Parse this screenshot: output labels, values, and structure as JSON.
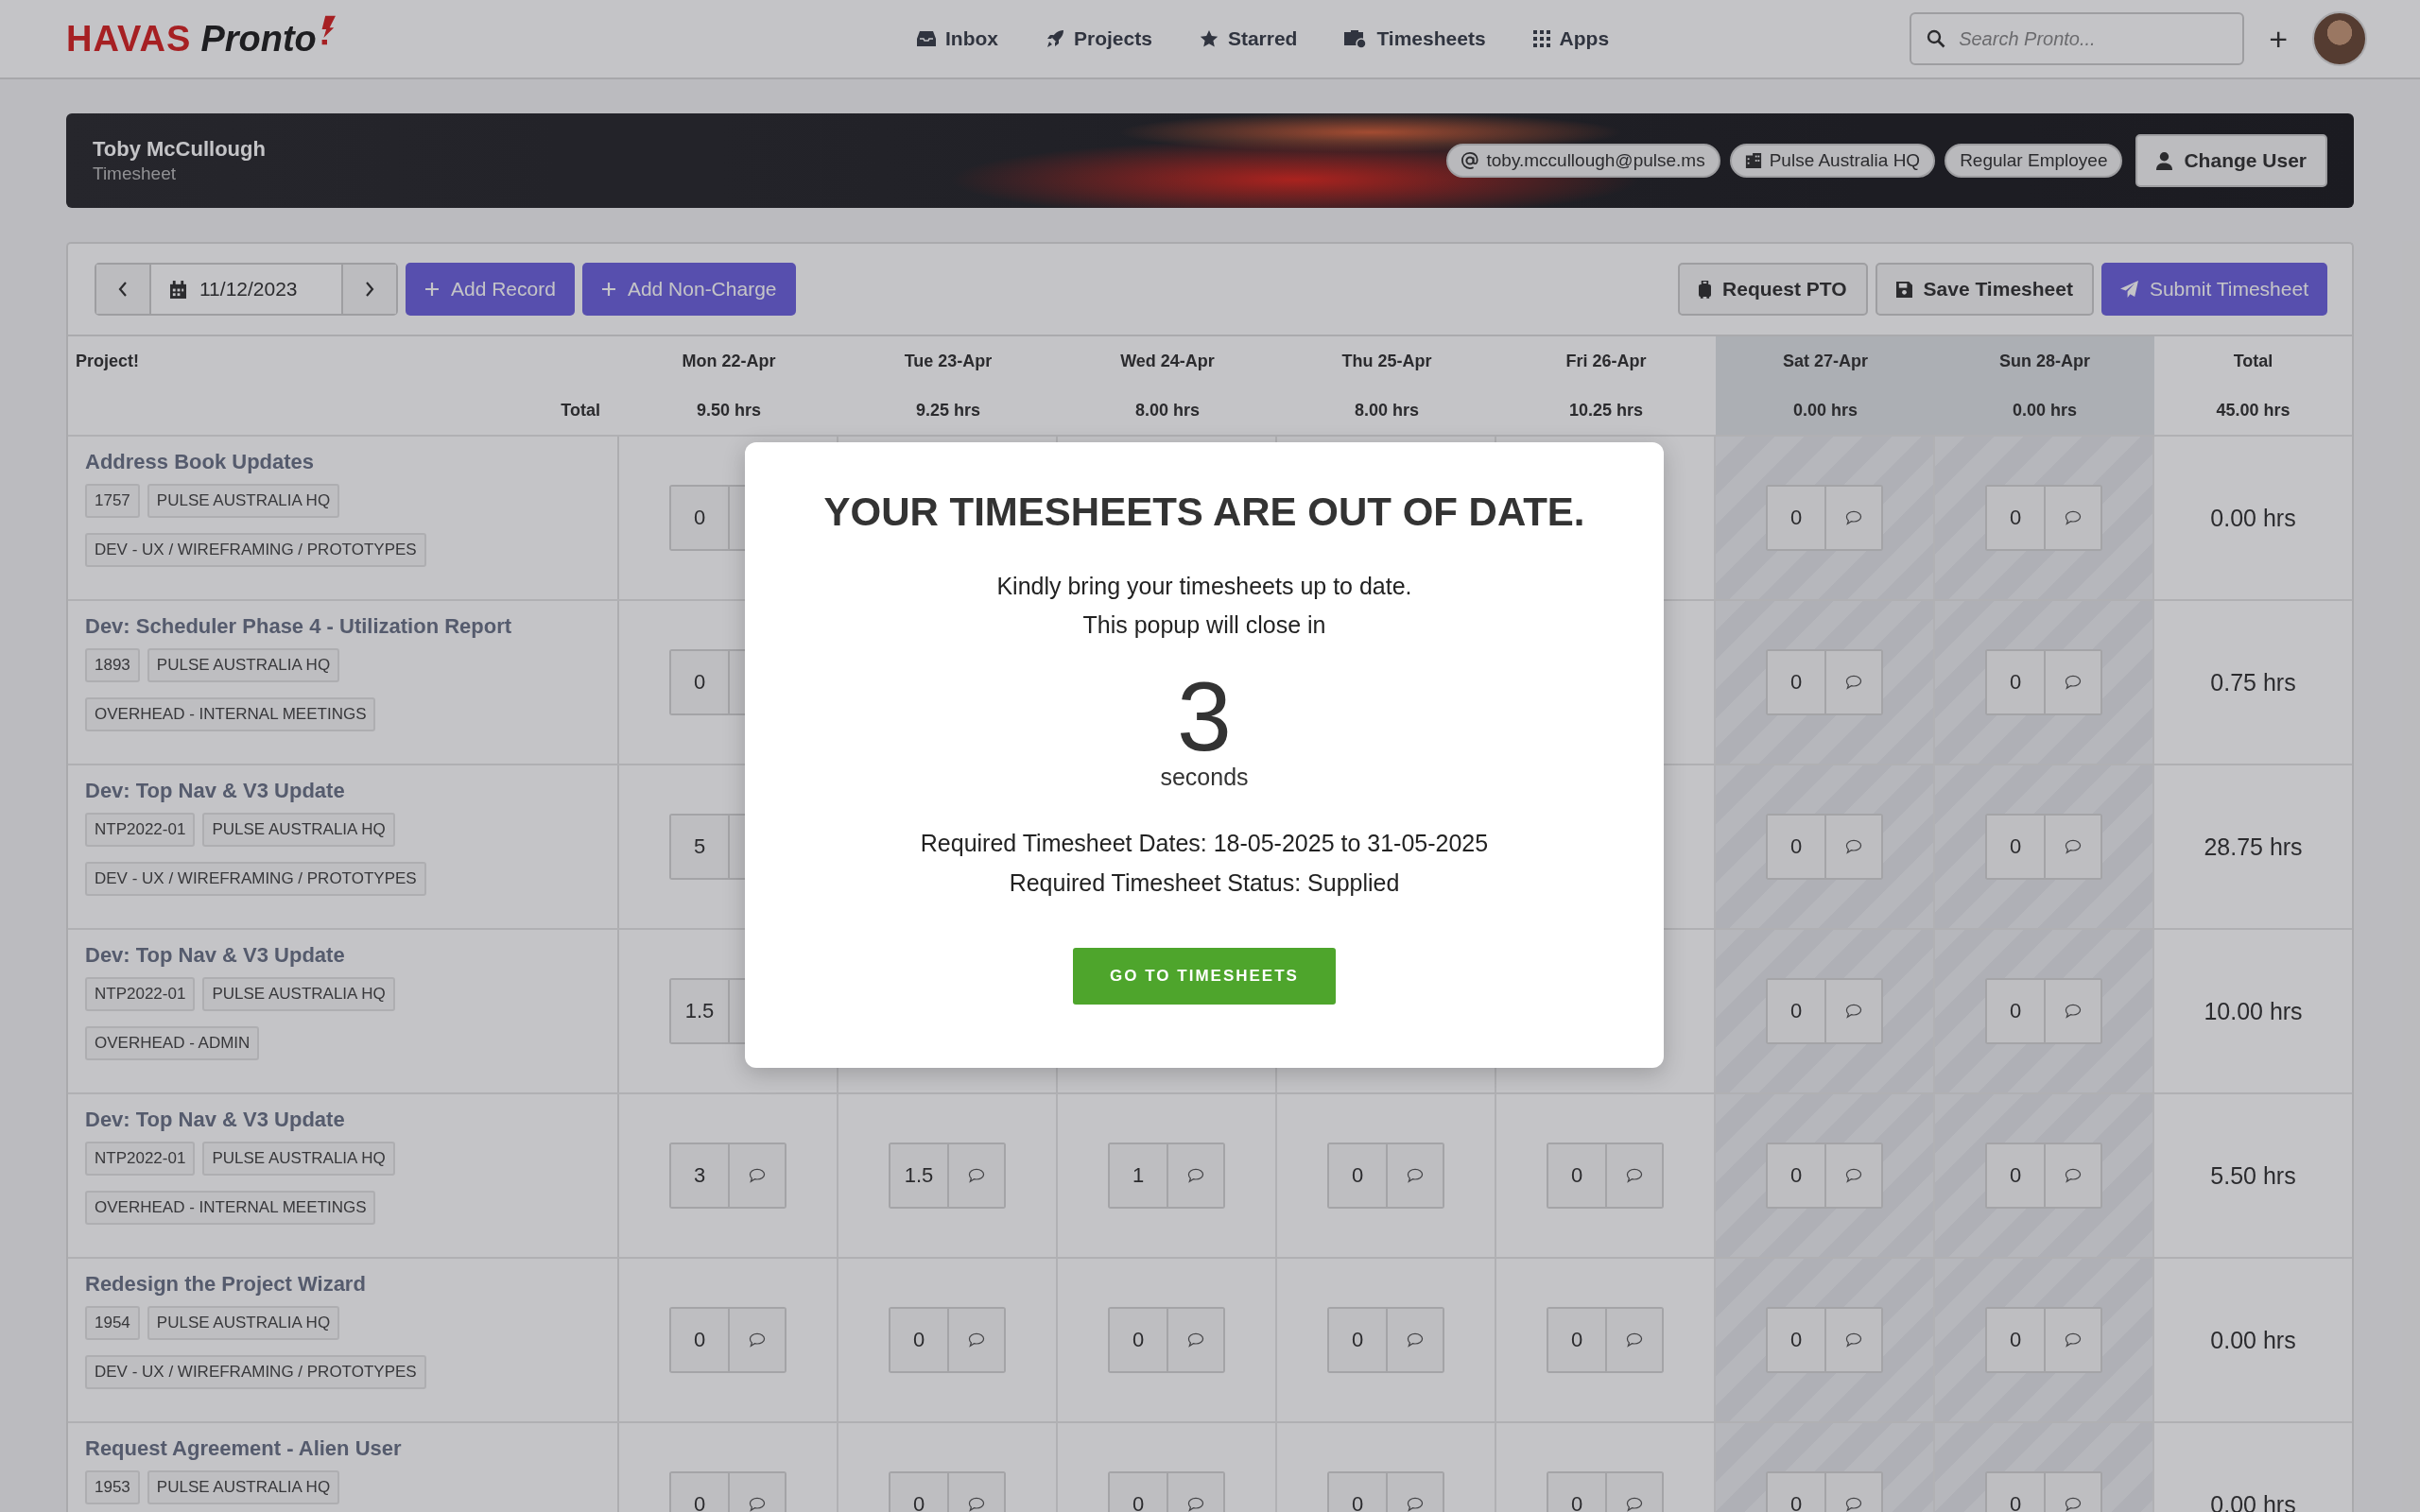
{
  "nav": {
    "brand": "HAVAS",
    "product": "Pronto",
    "items": [
      {
        "label": "Inbox"
      },
      {
        "label": "Projects"
      },
      {
        "label": "Starred"
      },
      {
        "label": "Timesheets"
      },
      {
        "label": "Apps"
      }
    ],
    "search": {
      "placeholder": "Search Pronto..."
    },
    "add": "+"
  },
  "header": {
    "name": "Toby McCullough",
    "subtitle": "Timesheet",
    "badges": [
      {
        "kind": "email",
        "label": "toby.mccullough@pulse.ms"
      },
      {
        "kind": "office",
        "label": "Pulse Australia HQ"
      },
      {
        "kind": "plain",
        "label": "Regular Employee"
      }
    ],
    "change_user": "Change User"
  },
  "toolbar": {
    "date": "11/12/2023",
    "left_buttons": [
      "Add Record",
      "Add Non-Charge"
    ],
    "right_buttons": [
      {
        "kind": "pto",
        "label": "Request PTO"
      },
      {
        "kind": "save",
        "label": "Save Timesheet"
      },
      {
        "kind": "submit",
        "label": "Submit Timesheet"
      }
    ]
  },
  "table": {
    "project_heading": "Project!",
    "total_label": "Total",
    "days": [
      {
        "label": "Mon 22-Apr",
        "total": "9.50 hrs",
        "weekend": false
      },
      {
        "label": "Tue 23-Apr",
        "total": "9.25 hrs",
        "weekend": false
      },
      {
        "label": "Wed 24-Apr",
        "total": "8.00 hrs",
        "weekend": false
      },
      {
        "label": "Thu 25-Apr",
        "total": "8.00 hrs",
        "weekend": false
      },
      {
        "label": "Fri 26-Apr",
        "total": "10.25 hrs",
        "weekend": false
      },
      {
        "label": "Sat 27-Apr",
        "total": "0.00 hrs",
        "weekend": true
      },
      {
        "label": "Sun 28-Apr",
        "total": "0.00 hrs",
        "weekend": true
      }
    ],
    "total_column": {
      "label": "Total",
      "total": "45.00 hrs"
    },
    "rows": [
      {
        "name": "Address Book Updates",
        "tags": [
          "1757",
          "PULSE AUSTRALIA HQ"
        ],
        "category": "DEV - UX / WIREFRAMING / PROTOTYPES",
        "hours": {
          "mon": "0",
          "sat": "0",
          "sun": "0"
        },
        "total": "0.00 hrs"
      },
      {
        "name": "Dev: Scheduler Phase 4 - Utilization Report",
        "tags": [
          "1893",
          "PULSE AUSTRALIA HQ"
        ],
        "category": "OVERHEAD - INTERNAL MEETINGS",
        "hours": {
          "mon": "0",
          "sat": "0",
          "sun": "0"
        },
        "total": "0.75 hrs"
      },
      {
        "name": "Dev: Top Nav & V3 Update",
        "tags": [
          "NTP2022-01",
          "PULSE AUSTRALIA HQ"
        ],
        "category": "DEV - UX / WIREFRAMING / PROTOTYPES",
        "hours": {
          "mon": "5",
          "sat": "0",
          "sun": "0"
        },
        "total": "28.75 hrs"
      },
      {
        "name": "Dev: Top Nav & V3 Update",
        "tags": [
          "NTP2022-01",
          "PULSE AUSTRALIA HQ"
        ],
        "category": "OVERHEAD - ADMIN",
        "hours": {
          "mon": "1.5",
          "sat": "0",
          "sun": "0"
        },
        "total": "10.00 hrs"
      },
      {
        "name": "Dev: Top Nav & V3 Update",
        "tags": [
          "NTP2022-01",
          "PULSE AUSTRALIA HQ"
        ],
        "category": "OVERHEAD - INTERNAL MEETINGS",
        "hours": {
          "mon": "3",
          "tue": "1.5",
          "wed": "1",
          "thu": "0",
          "fri": "0",
          "sat": "0",
          "sun": "0"
        },
        "total": "5.50 hrs"
      },
      {
        "name": "Redesign the Project Wizard",
        "tags": [
          "1954",
          "PULSE AUSTRALIA HQ"
        ],
        "category": "DEV - UX / WIREFRAMING / PROTOTYPES",
        "hours": {
          "mon": "0",
          "tue": "0",
          "wed": "0",
          "thu": "0",
          "fri": "0",
          "sat": "0",
          "sun": "0"
        },
        "total": "0.00 hrs"
      },
      {
        "name": "Request Agreement - Alien User",
        "tags": [
          "1953",
          "PULSE AUSTRALIA HQ"
        ],
        "hours": {
          "mon": "0",
          "tue": "0",
          "wed": "0",
          "thu": "0",
          "fri": "0",
          "sat": "0",
          "sun": "0"
        },
        "total": "0.00 hrs"
      }
    ]
  },
  "modal": {
    "title": "YOUR TIMESHEETS ARE OUT OF DATE.",
    "lines": [
      "Kindly bring your timesheets up to date.",
      "This popup will close in"
    ],
    "countdown": "3",
    "unit": "seconds",
    "details": [
      "Required Timesheet Dates: 18-05-2025 to 31-05-2025",
      "Required Timesheet Status: Supplied"
    ],
    "button": "GO TO TIMESHEETS"
  }
}
